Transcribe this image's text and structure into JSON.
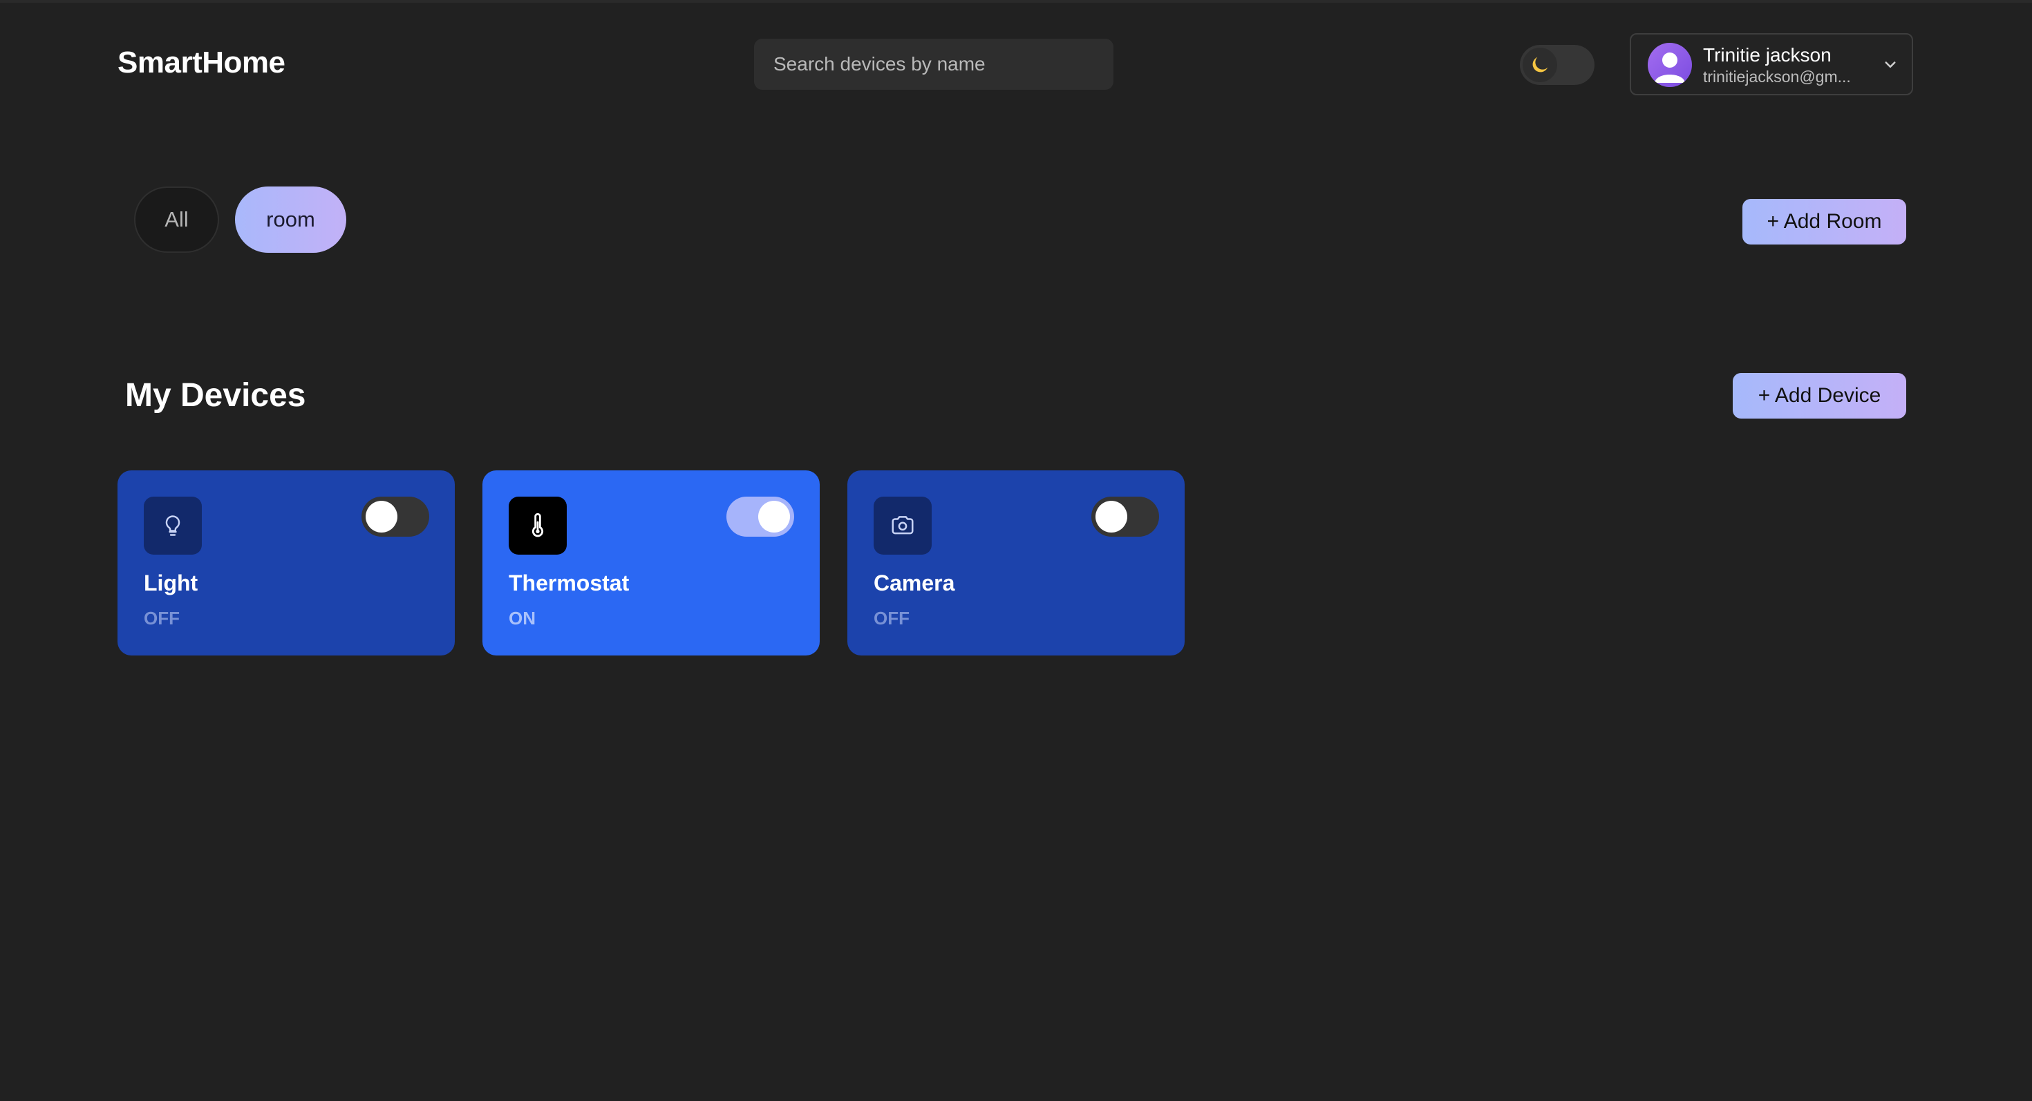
{
  "app": {
    "title": "SmartHome"
  },
  "search": {
    "placeholder": "Search devices by name"
  },
  "theme": {
    "mode": "dark",
    "icon": "moon-icon"
  },
  "user": {
    "name": "Trinitie jackson",
    "email": "trinitiejackson@gm..."
  },
  "filters": [
    {
      "label": "All",
      "active": false
    },
    {
      "label": "room",
      "active": true
    }
  ],
  "buttons": {
    "add_room": "+ Add Room",
    "add_device": "+ Add Device"
  },
  "section": {
    "title": "My Devices"
  },
  "devices": [
    {
      "name": "Light",
      "status": "OFF",
      "on": false,
      "icon": "lightbulb-icon"
    },
    {
      "name": "Thermostat",
      "status": "ON",
      "on": true,
      "icon": "thermometer-icon"
    },
    {
      "name": "Camera",
      "status": "OFF",
      "on": false,
      "icon": "camera-icon"
    }
  ],
  "colors": {
    "background": "#212121",
    "card_off": "#1c43ac",
    "card_on": "#2b68f3",
    "accent_gradient_start": "#a6b9fb",
    "accent_gradient_end": "#c4b0f7"
  }
}
